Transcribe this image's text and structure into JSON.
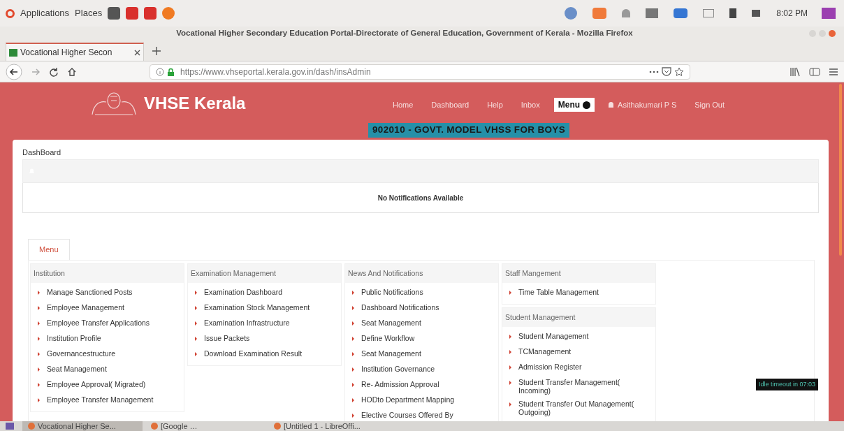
{
  "system_bar": {
    "menus": [
      "Applications",
      "Places"
    ],
    "clock": "8:02 PM"
  },
  "window": {
    "title": "Vocational Higher Secondary Education Portal-Directorate of General Education, Government of Kerala - Mozilla Firefox"
  },
  "browser": {
    "tabs": [
      {
        "label": "Vocational Higher Secon",
        "selected": true
      }
    ],
    "url": "https://www.vhseportal.kerala.gov.in/dash/insAdmin"
  },
  "site": {
    "brand": "VHSE Kerala",
    "nav": [
      {
        "label": "Home",
        "kind": "link"
      },
      {
        "label": "Dashboard",
        "kind": "link"
      },
      {
        "label": "Help",
        "kind": "link"
      },
      {
        "label": "Inbox",
        "kind": "link"
      },
      {
        "label": "Menu",
        "kind": "menu"
      },
      {
        "label": "Asithakumari P S",
        "kind": "user"
      },
      {
        "label": "Sign Out",
        "kind": "link"
      }
    ],
    "institution": "902010 - GOVT. MODEL VHSS FOR BOYS"
  },
  "page": {
    "breadcrumb": "DashBoard",
    "notice": "No Notifications Available"
  },
  "menu_tab": {
    "label": "Menu",
    "selected": true
  },
  "menu_columns": [
    [
      {
        "title": "Institution",
        "items": [
          "Manage Sanctioned Posts",
          "Employee Management",
          "Employee Transfer Applications",
          "Institution Profile",
          "Governancestructure",
          "Seat Management",
          "Employee Approval( Migrated)",
          "Employee Transfer Management"
        ]
      }
    ],
    [
      {
        "title": "Examination Management",
        "items": [
          "Examination Dashboard",
          "Examination Stock Management",
          "Examination Infrastructure",
          "Issue Packets",
          "Download Examination Result"
        ]
      }
    ],
    [
      {
        "title": "News And Notifications",
        "items": [
          "Public Notifications",
          "Dashboard Notifications",
          "Seat Management",
          "Define Workflow",
          "Seat Management",
          "Institution Governance",
          "Re- Admission Approval",
          "HODto Department Mapping",
          "Elective Courses Offered By"
        ]
      }
    ],
    [
      {
        "title": "Staff Mangement",
        "items": [
          "Time Table Management"
        ]
      },
      {
        "title": "Student Management",
        "items": [
          "Student Management",
          "TCManagement",
          "Admission Register",
          "Student Transfer Management( Incoming)",
          "Student Transfer Out Management( Outgoing)"
        ]
      }
    ]
  ],
  "idle_timeout": "Idle timeout in 07:03",
  "taskbar": [
    {
      "label": "Vocational Higher Se...",
      "selected": true
    },
    {
      "label": "[Google …",
      "selected": false
    },
    {
      "label": "[Untitled 1 - LibreOffi...",
      "selected": false
    }
  ]
}
